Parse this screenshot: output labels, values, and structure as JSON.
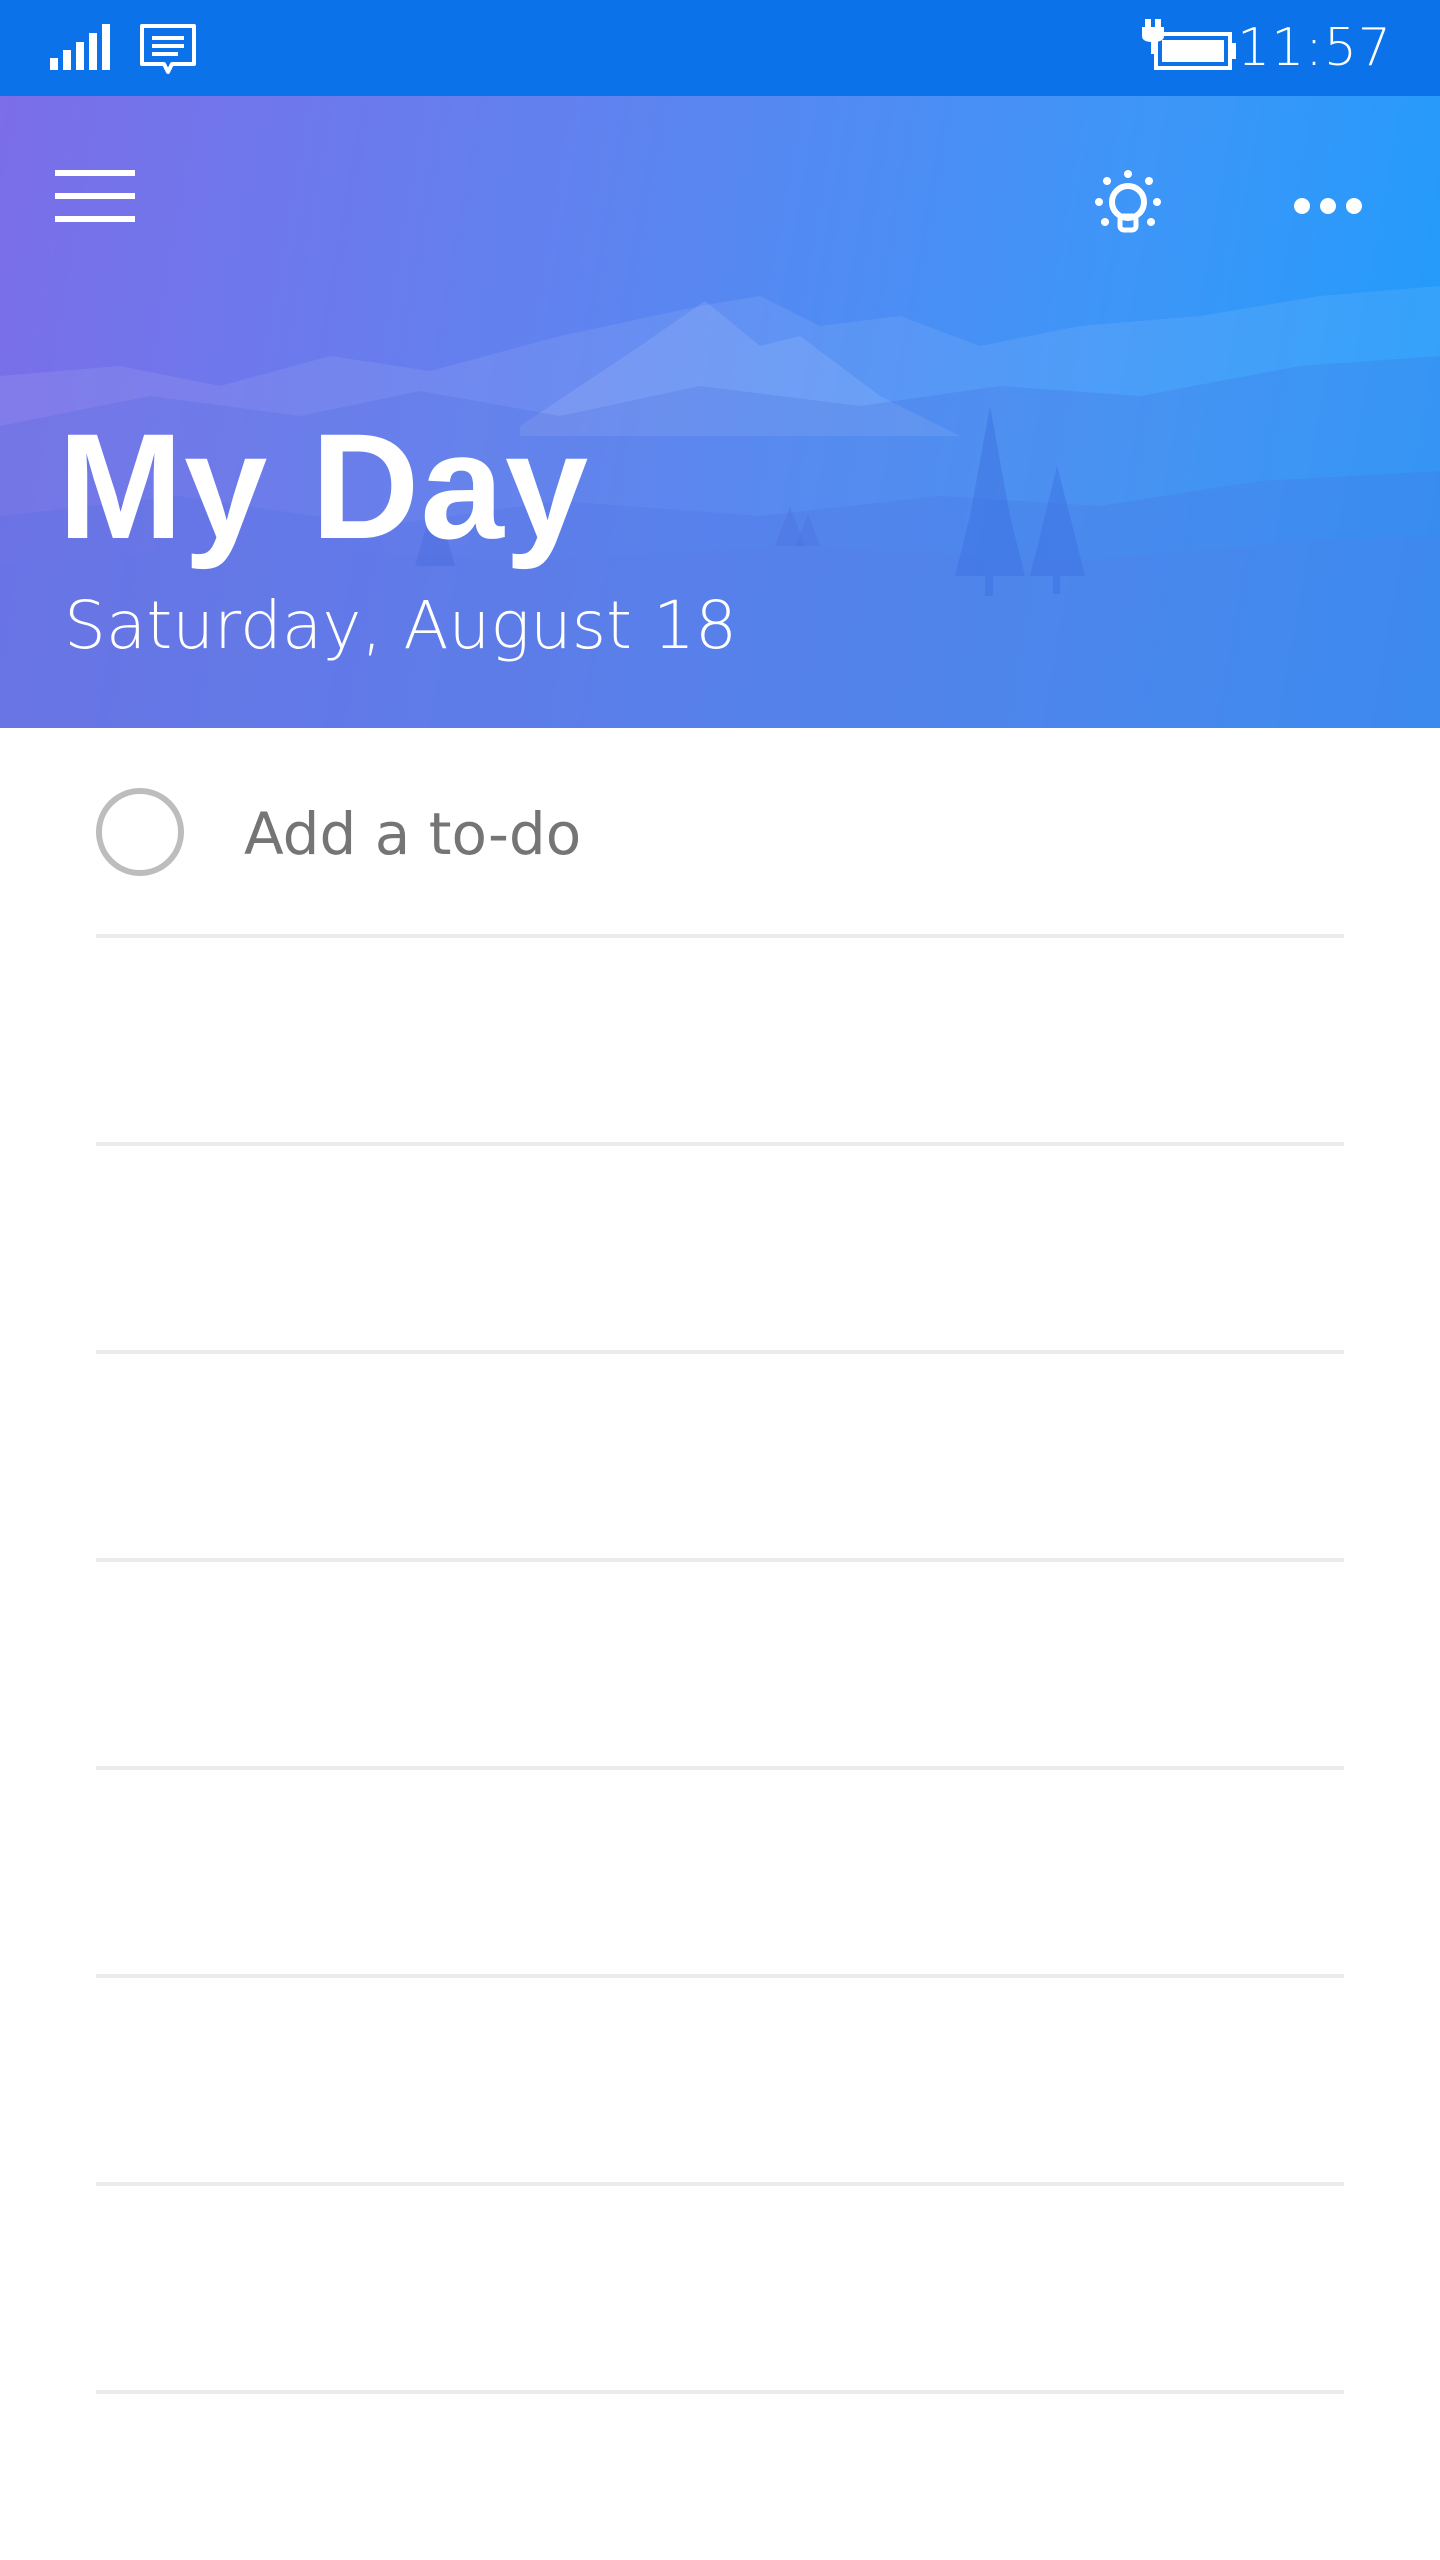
{
  "status_bar": {
    "time": "11:57",
    "signal_icon": "signal-strength-icon",
    "message_icon": "message-notification-icon",
    "battery_icon": "battery-charging-icon"
  },
  "header": {
    "title": "My Day",
    "date": "Saturday, August 18",
    "menu_icon": "hamburger-menu-icon",
    "suggestions_icon": "lightbulb-icon",
    "more_icon": "more-options-icon",
    "gradient_colors": [
      "#7b6ee8",
      "#5f83f0",
      "#3d96f8",
      "#1f9cfb"
    ]
  },
  "todo": {
    "add_placeholder": "Add a to-do"
  },
  "colors": {
    "status_bar": "#0b72ea",
    "divider": "#ebebeb",
    "placeholder_text": "#757575",
    "circle": "#bdbdbd"
  }
}
